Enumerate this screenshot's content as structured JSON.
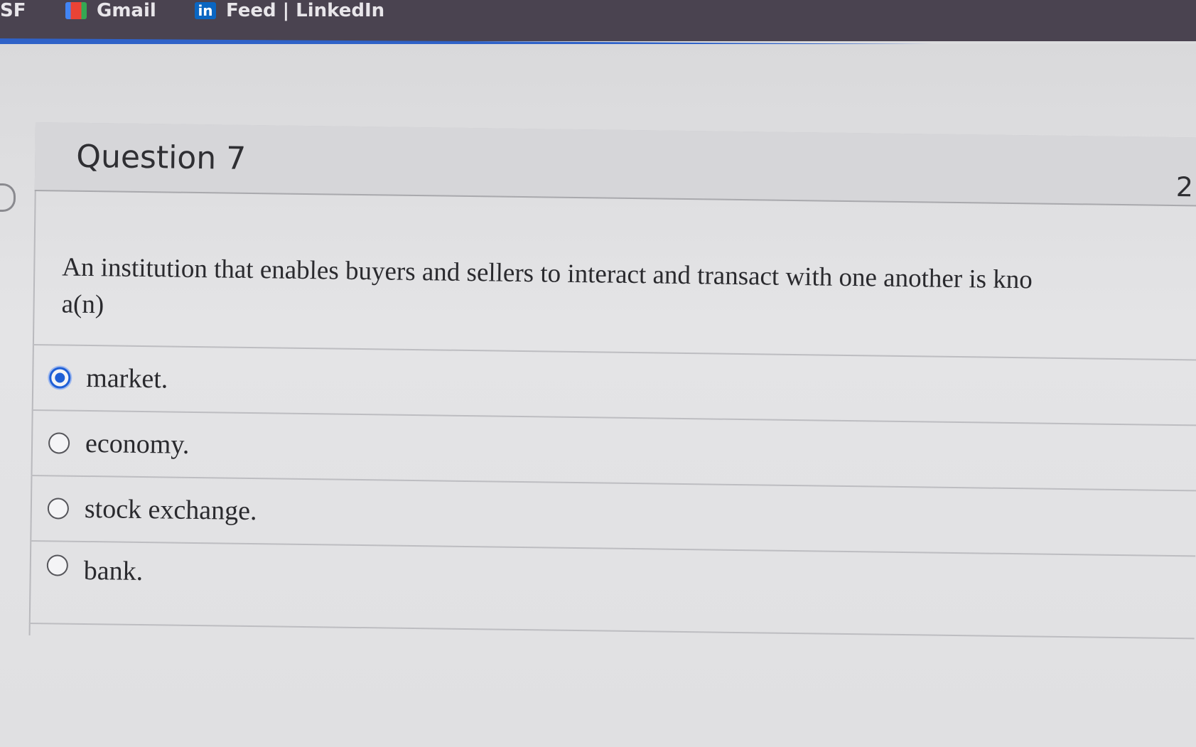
{
  "bookmarks": [
    {
      "label": "SF",
      "icon": "bookmark-icon"
    },
    {
      "label": "Gmail",
      "icon": "gmail-icon"
    },
    {
      "label": "Feed | LinkedIn",
      "icon": "linkedin-icon",
      "icon_text": "in"
    }
  ],
  "question": {
    "title": "Question 7",
    "points": "2",
    "text_line1": "An institution that enables buyers and sellers to interact and transact with one another is kno",
    "text_line2": "a(n)"
  },
  "answers": [
    {
      "label": "market.",
      "selected": true
    },
    {
      "label": "economy.",
      "selected": false
    },
    {
      "label": "stock exchange.",
      "selected": false
    },
    {
      "label": "bank.",
      "selected": false
    }
  ],
  "colors": {
    "accent": "#1f5fd6",
    "bookmarks_bar": "#4a4350"
  }
}
